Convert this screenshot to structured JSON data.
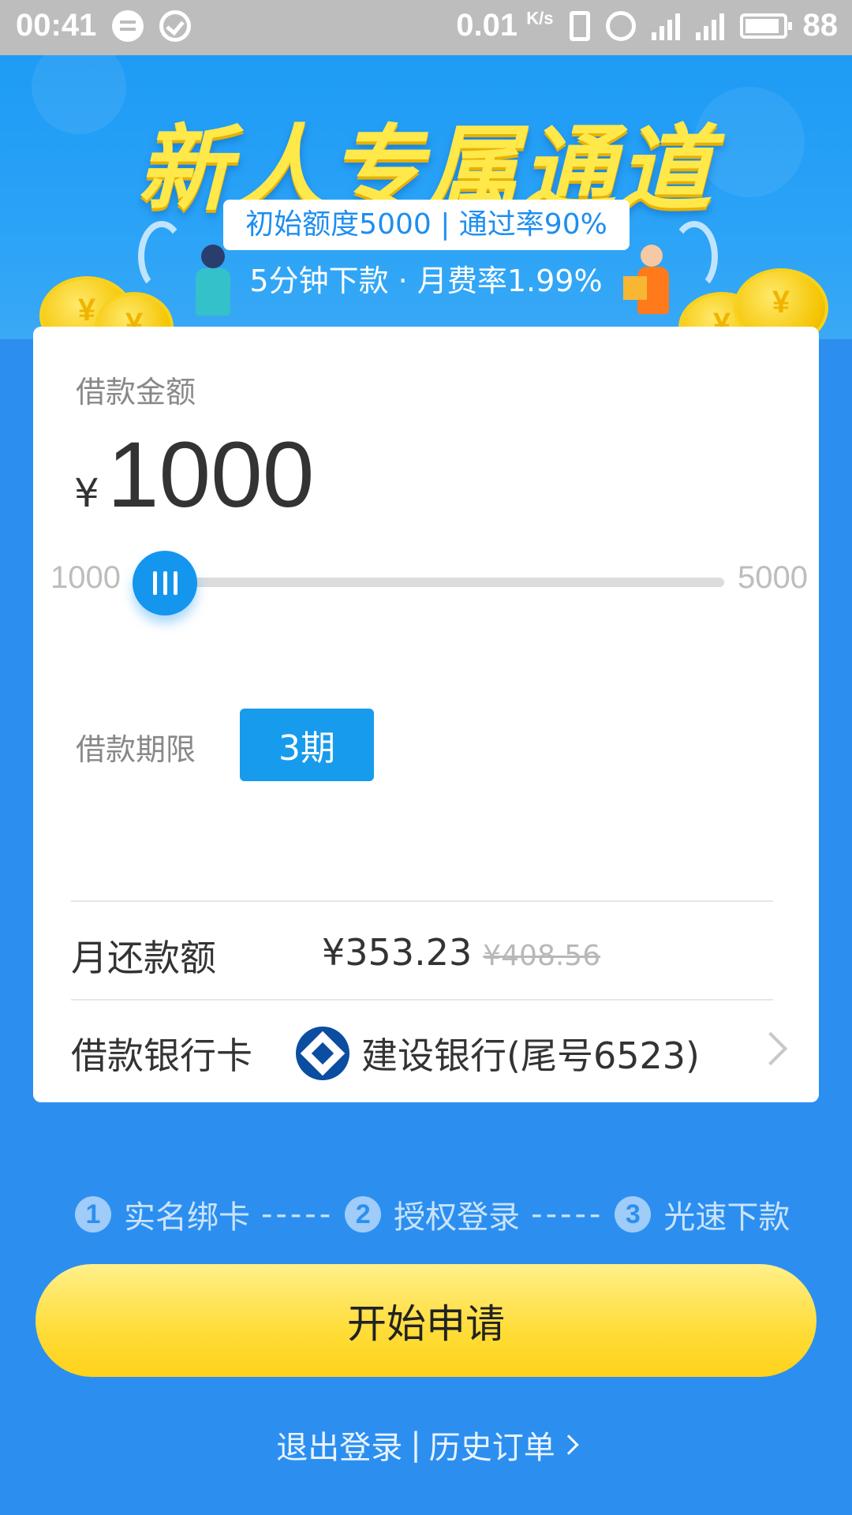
{
  "status_bar": {
    "time": "00:41",
    "speed": "0.01",
    "speed_unit": "K/s",
    "battery": "88"
  },
  "banner": {
    "title": "新人专属通道",
    "pill": "初始额度5000 | 通过率90%",
    "subtitle": "5分钟下款 · 月费率1.99%"
  },
  "loan": {
    "amount_label": "借款金额",
    "currency": "¥",
    "amount": "1000",
    "slider_min": "1000",
    "slider_max": "5000",
    "slider_value_fraction": 0,
    "term_label": "借款期限",
    "term_option": "3期",
    "repay_label": "月还款额",
    "repay_now": "¥353.23",
    "repay_old": "¥408.56",
    "bank_label": "借款银行卡",
    "bank_name": "建设银行(尾号6523)"
  },
  "steps": [
    {
      "num": "1",
      "label": "实名绑卡"
    },
    {
      "num": "2",
      "label": "授权登录"
    },
    {
      "num": "3",
      "label": "光速下款"
    }
  ],
  "step_dash": "-----",
  "apply_button": "开始申请",
  "footer": {
    "logout": "退出登录",
    "separator": "|",
    "history": "历史订单"
  },
  "colors": {
    "background": "#2c8ff0",
    "accent": "#179bec",
    "button": "#ffdc37"
  }
}
